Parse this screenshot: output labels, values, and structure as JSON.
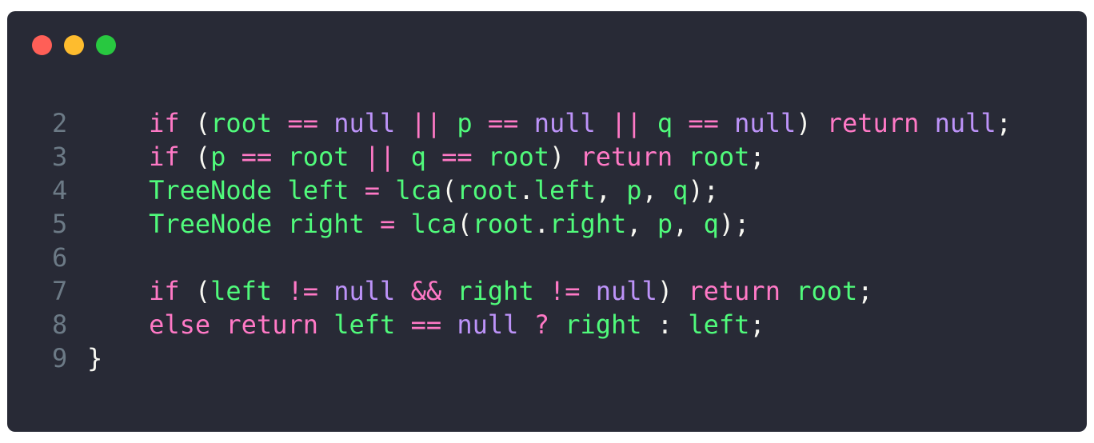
{
  "window": {
    "controls": [
      {
        "name": "close",
        "color": "#ff5f57"
      },
      {
        "name": "minimize",
        "color": "#febc2e"
      },
      {
        "name": "maximize",
        "color": "#28c840"
      }
    ]
  },
  "editor": {
    "lines": [
      {
        "number": "2",
        "tokens": [
          {
            "t": "    ",
            "c": "pn"
          },
          {
            "t": "if",
            "c": "kw"
          },
          {
            "t": " (",
            "c": "pn"
          },
          {
            "t": "root",
            "c": "id"
          },
          {
            "t": " ",
            "c": "pn"
          },
          {
            "t": "==",
            "c": "op"
          },
          {
            "t": " ",
            "c": "pn"
          },
          {
            "t": "null",
            "c": "nl"
          },
          {
            "t": " ",
            "c": "pn"
          },
          {
            "t": "||",
            "c": "op"
          },
          {
            "t": " ",
            "c": "pn"
          },
          {
            "t": "p",
            "c": "id"
          },
          {
            "t": " ",
            "c": "pn"
          },
          {
            "t": "==",
            "c": "op"
          },
          {
            "t": " ",
            "c": "pn"
          },
          {
            "t": "null",
            "c": "nl"
          },
          {
            "t": " ",
            "c": "pn"
          },
          {
            "t": "||",
            "c": "op"
          },
          {
            "t": " ",
            "c": "pn"
          },
          {
            "t": "q",
            "c": "id"
          },
          {
            "t": " ",
            "c": "pn"
          },
          {
            "t": "==",
            "c": "op"
          },
          {
            "t": " ",
            "c": "pn"
          },
          {
            "t": "null",
            "c": "nl"
          },
          {
            "t": ") ",
            "c": "pn"
          },
          {
            "t": "return",
            "c": "kw"
          },
          {
            "t": " ",
            "c": "pn"
          },
          {
            "t": "null",
            "c": "nl"
          },
          {
            "t": ";",
            "c": "pn"
          }
        ]
      },
      {
        "number": "3",
        "tokens": [
          {
            "t": "    ",
            "c": "pn"
          },
          {
            "t": "if",
            "c": "kw"
          },
          {
            "t": " (",
            "c": "pn"
          },
          {
            "t": "p",
            "c": "id"
          },
          {
            "t": " ",
            "c": "pn"
          },
          {
            "t": "==",
            "c": "op"
          },
          {
            "t": " ",
            "c": "pn"
          },
          {
            "t": "root",
            "c": "id"
          },
          {
            "t": " ",
            "c": "pn"
          },
          {
            "t": "||",
            "c": "op"
          },
          {
            "t": " ",
            "c": "pn"
          },
          {
            "t": "q",
            "c": "id"
          },
          {
            "t": " ",
            "c": "pn"
          },
          {
            "t": "==",
            "c": "op"
          },
          {
            "t": " ",
            "c": "pn"
          },
          {
            "t": "root",
            "c": "id"
          },
          {
            "t": ") ",
            "c": "pn"
          },
          {
            "t": "return",
            "c": "kw"
          },
          {
            "t": " ",
            "c": "pn"
          },
          {
            "t": "root",
            "c": "id"
          },
          {
            "t": ";",
            "c": "pn"
          }
        ]
      },
      {
        "number": "4",
        "tokens": [
          {
            "t": "    ",
            "c": "pn"
          },
          {
            "t": "TreeNode",
            "c": "id"
          },
          {
            "t": " ",
            "c": "pn"
          },
          {
            "t": "left",
            "c": "id"
          },
          {
            "t": " ",
            "c": "pn"
          },
          {
            "t": "=",
            "c": "op"
          },
          {
            "t": " ",
            "c": "pn"
          },
          {
            "t": "lca",
            "c": "id"
          },
          {
            "t": "(",
            "c": "pn"
          },
          {
            "t": "root",
            "c": "id"
          },
          {
            "t": ".",
            "c": "pn"
          },
          {
            "t": "left",
            "c": "id"
          },
          {
            "t": ", ",
            "c": "pn"
          },
          {
            "t": "p",
            "c": "id"
          },
          {
            "t": ", ",
            "c": "pn"
          },
          {
            "t": "q",
            "c": "id"
          },
          {
            "t": ");",
            "c": "pn"
          }
        ]
      },
      {
        "number": "5",
        "tokens": [
          {
            "t": "    ",
            "c": "pn"
          },
          {
            "t": "TreeNode",
            "c": "id"
          },
          {
            "t": " ",
            "c": "pn"
          },
          {
            "t": "right",
            "c": "id"
          },
          {
            "t": " ",
            "c": "pn"
          },
          {
            "t": "=",
            "c": "op"
          },
          {
            "t": " ",
            "c": "pn"
          },
          {
            "t": "lca",
            "c": "id"
          },
          {
            "t": "(",
            "c": "pn"
          },
          {
            "t": "root",
            "c": "id"
          },
          {
            "t": ".",
            "c": "pn"
          },
          {
            "t": "right",
            "c": "id"
          },
          {
            "t": ", ",
            "c": "pn"
          },
          {
            "t": "p",
            "c": "id"
          },
          {
            "t": ", ",
            "c": "pn"
          },
          {
            "t": "q",
            "c": "id"
          },
          {
            "t": ");",
            "c": "pn"
          }
        ]
      },
      {
        "number": "6",
        "tokens": []
      },
      {
        "number": "7",
        "tokens": [
          {
            "t": "    ",
            "c": "pn"
          },
          {
            "t": "if",
            "c": "kw"
          },
          {
            "t": " (",
            "c": "pn"
          },
          {
            "t": "left",
            "c": "id"
          },
          {
            "t": " ",
            "c": "pn"
          },
          {
            "t": "!=",
            "c": "op"
          },
          {
            "t": " ",
            "c": "pn"
          },
          {
            "t": "null",
            "c": "nl"
          },
          {
            "t": " ",
            "c": "pn"
          },
          {
            "t": "&&",
            "c": "op"
          },
          {
            "t": " ",
            "c": "pn"
          },
          {
            "t": "right",
            "c": "id"
          },
          {
            "t": " ",
            "c": "pn"
          },
          {
            "t": "!=",
            "c": "op"
          },
          {
            "t": " ",
            "c": "pn"
          },
          {
            "t": "null",
            "c": "nl"
          },
          {
            "t": ") ",
            "c": "pn"
          },
          {
            "t": "return",
            "c": "kw"
          },
          {
            "t": " ",
            "c": "pn"
          },
          {
            "t": "root",
            "c": "id"
          },
          {
            "t": ";",
            "c": "pn"
          }
        ]
      },
      {
        "number": "8",
        "tokens": [
          {
            "t": "    ",
            "c": "pn"
          },
          {
            "t": "else",
            "c": "kw"
          },
          {
            "t": " ",
            "c": "pn"
          },
          {
            "t": "return",
            "c": "kw"
          },
          {
            "t": " ",
            "c": "pn"
          },
          {
            "t": "left",
            "c": "id"
          },
          {
            "t": " ",
            "c": "pn"
          },
          {
            "t": "==",
            "c": "op"
          },
          {
            "t": " ",
            "c": "pn"
          },
          {
            "t": "null",
            "c": "nl"
          },
          {
            "t": " ",
            "c": "pn"
          },
          {
            "t": "?",
            "c": "op"
          },
          {
            "t": " ",
            "c": "pn"
          },
          {
            "t": "right",
            "c": "id"
          },
          {
            "t": " : ",
            "c": "pn"
          },
          {
            "t": "left",
            "c": "id"
          },
          {
            "t": ";",
            "c": "pn"
          }
        ]
      },
      {
        "number": "9",
        "tokens": [
          {
            "t": "}",
            "c": "pn"
          }
        ]
      }
    ]
  }
}
